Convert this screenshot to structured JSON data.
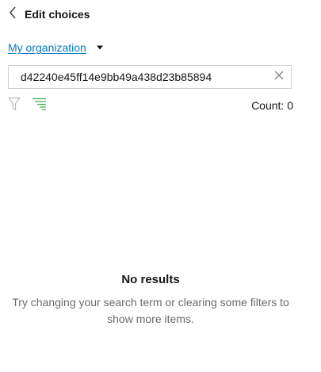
{
  "header": {
    "title": "Edit choices",
    "back_icon": "chevron-left-icon"
  },
  "scope": {
    "label": "My organization",
    "caret_icon": "caret-down-icon"
  },
  "search": {
    "value": "d42240e45ff14e9bb49a438d23b85894",
    "clear_icon": "close-icon"
  },
  "toolbar": {
    "filter_icon": "filter-icon",
    "sort_icon": "sort-list-icon",
    "count_label": "Count: 0"
  },
  "empty_state": {
    "title": "No results",
    "message": "Try changing your search term or clearing some filters to show more items."
  },
  "colors": {
    "link": "#0079c1",
    "sort_icon": "#35ac46",
    "muted_text": "#6a6a6a",
    "input_border": "#cfcfcf"
  }
}
